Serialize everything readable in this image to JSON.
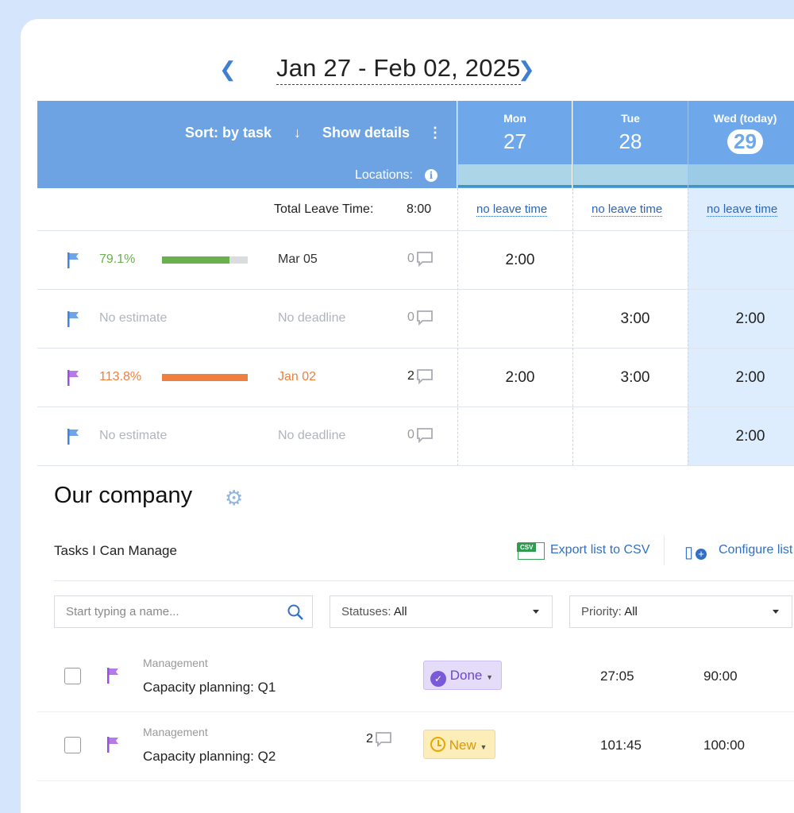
{
  "date_nav": {
    "range": "Jan 27 - Feb 02, 2025",
    "prev_icon": "chevron-left-icon",
    "next_icon": "chevron-right-icon"
  },
  "header": {
    "sort_label": "Sort: by task",
    "sort_icon": "arrow-down-icon",
    "show_details": "Show details",
    "more_icon": "kebab-icon",
    "locations": "Locations:",
    "info_icon": "info-icon"
  },
  "days": [
    {
      "name": "Mon",
      "date": "27"
    },
    {
      "name": "Tue",
      "date": "28"
    },
    {
      "name": "Wed (today)",
      "date": "29"
    }
  ],
  "leave": {
    "label": "Total Leave Time:",
    "total": "8:00",
    "per_day": [
      "no leave time",
      "no leave time",
      "no leave time"
    ]
  },
  "tasks": [
    {
      "flag_color": "#3d85e0",
      "estimate": "79.1%",
      "progress": 79.1,
      "estimate_color": "#6ab04c",
      "bar_color": "#6ab04c",
      "deadline": "Mar 05",
      "deadline_color": "#333",
      "comments": "0",
      "hours": [
        "2:00",
        "",
        ""
      ]
    },
    {
      "flag_color": "#3d85e0",
      "estimate": "No estimate",
      "estimate_color": "#b0b5bd",
      "deadline": "No deadline",
      "deadline_color": "#b0b5bd",
      "comments": "0",
      "hours": [
        "",
        "3:00",
        "2:00"
      ]
    },
    {
      "flag_color": "#9b4fe0",
      "estimate": "113.8%",
      "progress": 113.8,
      "estimate_color": "#ee7f3e",
      "bar_color": "#ee7f3e",
      "deadline": "Jan 02",
      "deadline_color": "#ee7f3e",
      "comments": "2",
      "hours": [
        "2:00",
        "3:00",
        "2:00"
      ]
    },
    {
      "flag_color": "#3d85e0",
      "estimate": "No estimate",
      "estimate_color": "#b0b5bd",
      "deadline": "No deadline",
      "deadline_color": "#b0b5bd",
      "comments": "0",
      "hours": [
        "",
        "",
        "2:00"
      ]
    }
  ],
  "company": {
    "title": "Our company",
    "subtitle": "Tasks I Can Manage",
    "export": "Export list to CSV",
    "csv_badge": "CSV",
    "configure": "Configure list"
  },
  "filters": {
    "search_placeholder": "Start typing a name...",
    "statuses_label": "Statuses:",
    "statuses_value": "All",
    "priority_label": "Priority:",
    "priority_value": "All"
  },
  "list": [
    {
      "project": "Management",
      "name": "Capacity planning: Q1",
      "comments": "",
      "status": "Done",
      "col1": "27:05",
      "col2": "90:00"
    },
    {
      "project": "Management",
      "name": "Capacity planning: Q2",
      "comments": "2",
      "status": "New",
      "col1": "101:45",
      "col2": "100:00"
    }
  ]
}
